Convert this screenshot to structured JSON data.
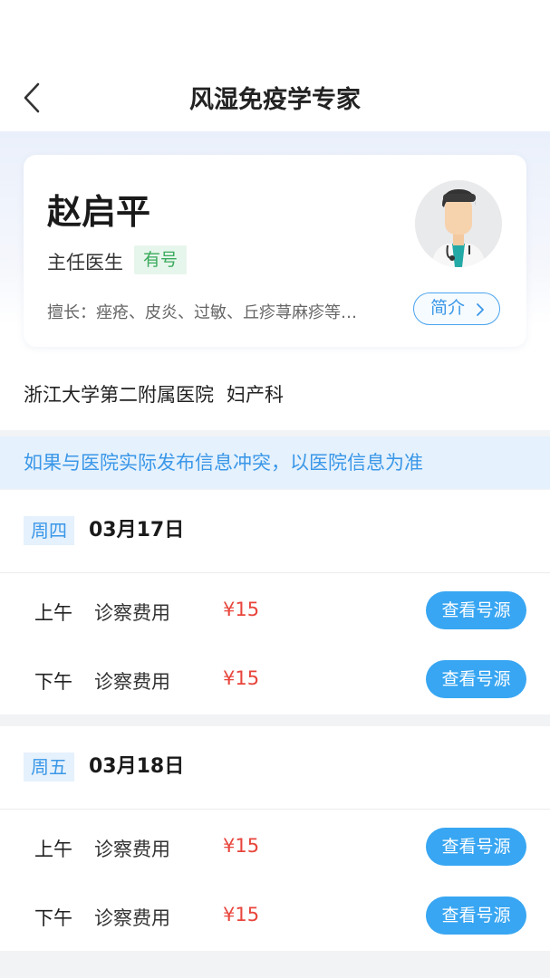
{
  "header": {
    "title": "风湿免疫学专家",
    "back_icon": "chevron-left-icon"
  },
  "doctor": {
    "name": "赵启平",
    "title": "主任医生",
    "availability_badge": "有号",
    "specialty": "擅长：痤疮、皮炎、过敏、丘疹荨麻疹等…",
    "intro_button": "简介",
    "avatar_icon": "doctor-avatar-icon"
  },
  "hospital": {
    "name": "浙江大学第二附属医院",
    "department": "妇产科"
  },
  "notice": "如果与医院实际发布信息冲突，以医院信息为准",
  "schedule": [
    {
      "weekday": "周四",
      "date": "03月17日",
      "slots": [
        {
          "period": "上午",
          "fee_label": "诊察费用",
          "price": "¥15",
          "button": "查看号源"
        },
        {
          "period": "下午",
          "fee_label": "诊察费用",
          "price": "¥15",
          "button": "查看号源"
        }
      ]
    },
    {
      "weekday": "周五",
      "date": "03月18日",
      "slots": [
        {
          "period": "上午",
          "fee_label": "诊察费用",
          "price": "¥15",
          "button": "查看号源"
        },
        {
          "period": "下午",
          "fee_label": "诊察费用",
          "price": "¥15",
          "button": "查看号源"
        }
      ]
    }
  ],
  "colors": {
    "accent": "#38a6f2",
    "price": "#e8453c",
    "badge_green": "#3aaa5c"
  }
}
